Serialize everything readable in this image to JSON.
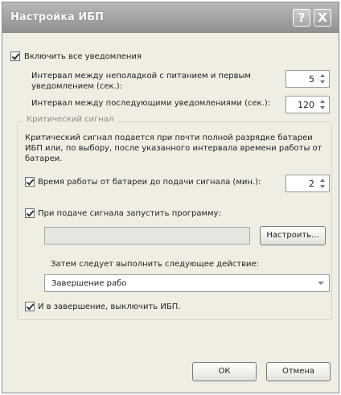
{
  "window": {
    "title": "Настройка ИБП",
    "help_label": "?",
    "close_label": "X"
  },
  "enable_notifications": {
    "label": "Включить все уведомления",
    "checked": true
  },
  "interval_first": {
    "label": "Интервал между неполадкой с питанием и первым уведомлением (сек.):",
    "value": "5"
  },
  "interval_next": {
    "label": "Интервал между последующими уведомлениями (сек.):",
    "value": "120"
  },
  "critical": {
    "legend": "Критический сигнал",
    "description": "Критический сигнал подается при почти полной разрядке батареи ИБП или, по выбору, после указанного интервала времени работы от батареи.",
    "battery_time": {
      "label": "Время работы от батареи до подачи сигнала (мин.):",
      "value": "2",
      "checked": true
    },
    "run_program": {
      "label": "При подаче сигнала запустить программу:",
      "checked": true
    },
    "program_path": "",
    "configure_label": "Настроить...",
    "then_label": "Затем следует выполнить следующее действие:",
    "action_value": "Завершение рабо",
    "shutdown_ups": {
      "label": "И в завершение, выключить ИБП.",
      "checked": true
    }
  },
  "footer": {
    "ok_label": "ОК",
    "cancel_label": "Отмена"
  }
}
